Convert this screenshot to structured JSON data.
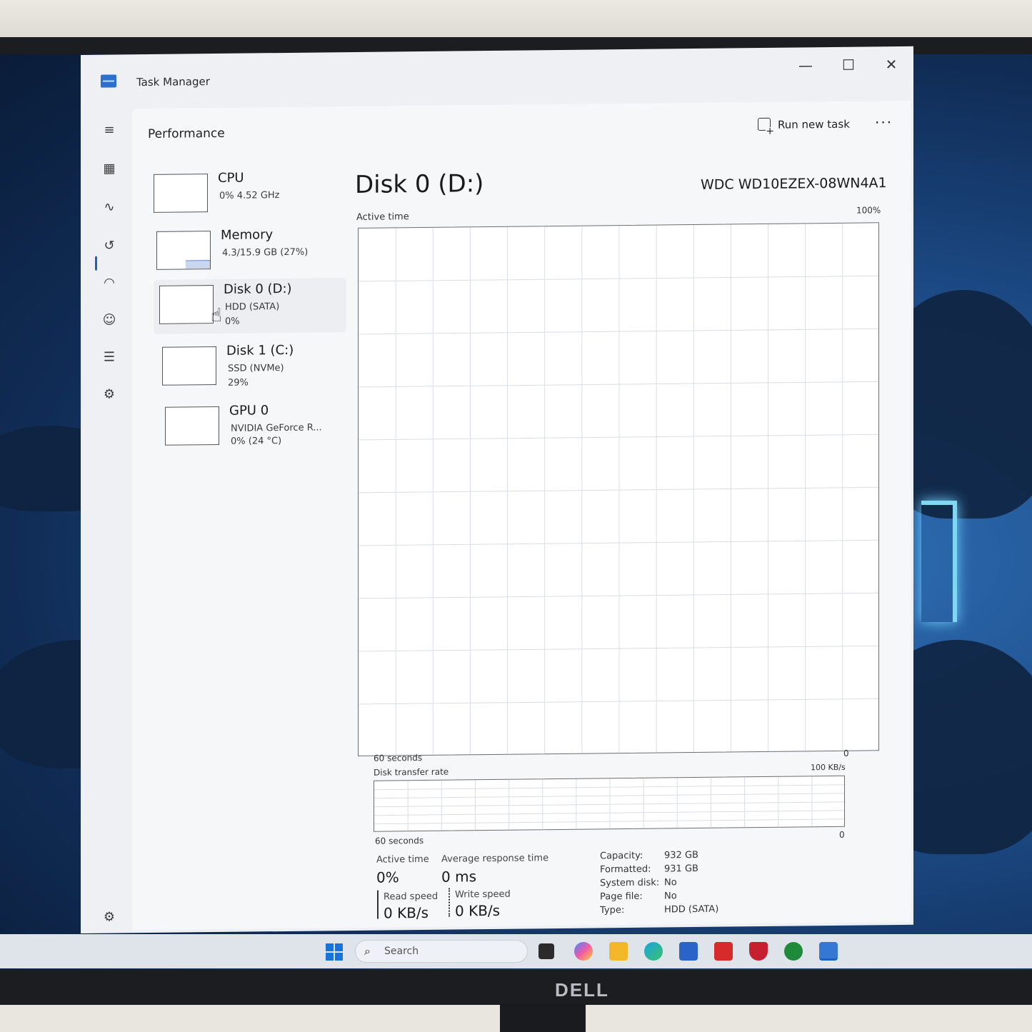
{
  "monitor": {
    "brand": "DELL"
  },
  "window": {
    "title": "Task Manager",
    "controls": {
      "minimize": "—",
      "maximize": "☐",
      "close": "✕"
    }
  },
  "nav": {
    "icons": [
      "menu-icon",
      "processes-icon",
      "performance-icon",
      "app-history-icon",
      "startup-apps-icon",
      "users-icon",
      "details-icon",
      "services-icon",
      "settings-icon"
    ]
  },
  "header": {
    "page_title": "Performance",
    "run_new_task": "Run new task",
    "more": "···"
  },
  "devices": [
    {
      "name": "CPU",
      "line1": "0%  4.52 GHz",
      "line2": ""
    },
    {
      "name": "Memory",
      "line1": "4.3/15.9 GB (27%)",
      "line2": ""
    },
    {
      "name": "Disk 0 (D:)",
      "line1": "HDD (SATA)",
      "line2": "0%"
    },
    {
      "name": "Disk 1 (C:)",
      "line1": "SSD (NVMe)",
      "line2": "29%"
    },
    {
      "name": "GPU 0",
      "line1": "NVIDIA GeForce R...",
      "line2": "0%  (24 °C)"
    }
  ],
  "detail": {
    "title": "Disk 0 (D:)",
    "model": "WDC WD10EZEX-08WN4A1",
    "active_time_graph": {
      "label": "Active time",
      "max": "100%",
      "time_label": "60 seconds",
      "min": "0"
    },
    "transfer_graph": {
      "label": "Disk transfer rate",
      "max": "100 KB/s",
      "time_label": "60 seconds",
      "min": "0"
    },
    "stats": {
      "active_time_label": "Active time",
      "active_time_value": "0%",
      "avg_response_label": "Average response time",
      "avg_response_value": "0 ms",
      "read_speed_label": "Read speed",
      "read_speed_value": "0 KB/s",
      "write_speed_label": "Write speed",
      "write_speed_value": "0 KB/s"
    },
    "properties": [
      {
        "key": "Capacity:",
        "value": "932 GB"
      },
      {
        "key": "Formatted:",
        "value": "931 GB"
      },
      {
        "key": "System disk:",
        "value": "No"
      },
      {
        "key": "Page file:",
        "value": "No"
      },
      {
        "key": "Type:",
        "value": "HDD (SATA)"
      }
    ]
  },
  "taskbar": {
    "search_placeholder": "Search",
    "apps": [
      "task-view-icon",
      "copilot-icon",
      "file-explorer-icon",
      "edge-icon",
      "store-icon",
      "l-app-icon",
      "mcafee-icon",
      "xbox-icon",
      "task-manager-taskbar-icon"
    ]
  }
}
